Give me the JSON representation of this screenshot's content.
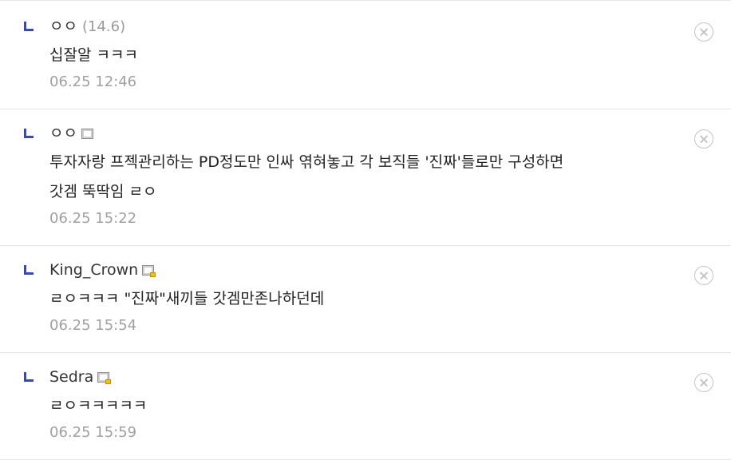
{
  "comments": [
    {
      "author": "ㅇㅇ",
      "level": "(14.6)",
      "member_icon": "none",
      "content": "십잘알 ㅋㅋㅋ",
      "timestamp": "06.25 12:46"
    },
    {
      "author": "ㅇㅇ",
      "member_icon": "fixed-nick-icon",
      "content": "투자자랑 프젝관리하는 PD정도만 인싸 엮혀놓고 각 보직들 '진짜'들로만 구성하면\n갓겜 뚝딱임 ㄹㅇ",
      "timestamp": "06.25 15:22"
    },
    {
      "author": "King_Crown",
      "member_icon": "gold-fixed-nick-icon",
      "content": "ㄹㅇㅋㅋㅋ \"진짜\"새끼들 갓겜만존나하던데",
      "timestamp": "06.25 15:54"
    },
    {
      "author": "Sedra",
      "member_icon": "gold-fixed-nick-icon",
      "content": "ㄹㅇㅋㅋㅋㅋㅋ",
      "timestamp": "06.25 15:59"
    }
  ],
  "icons": {
    "reply": "reply-arrow-icon",
    "delete": "delete-circle-x-icon"
  },
  "colors": {
    "reply_mark": "#3b4aa3",
    "divider": "#e4e6ee",
    "meta_text": "#a0a0a0",
    "gold_badge": "#f2c200"
  }
}
